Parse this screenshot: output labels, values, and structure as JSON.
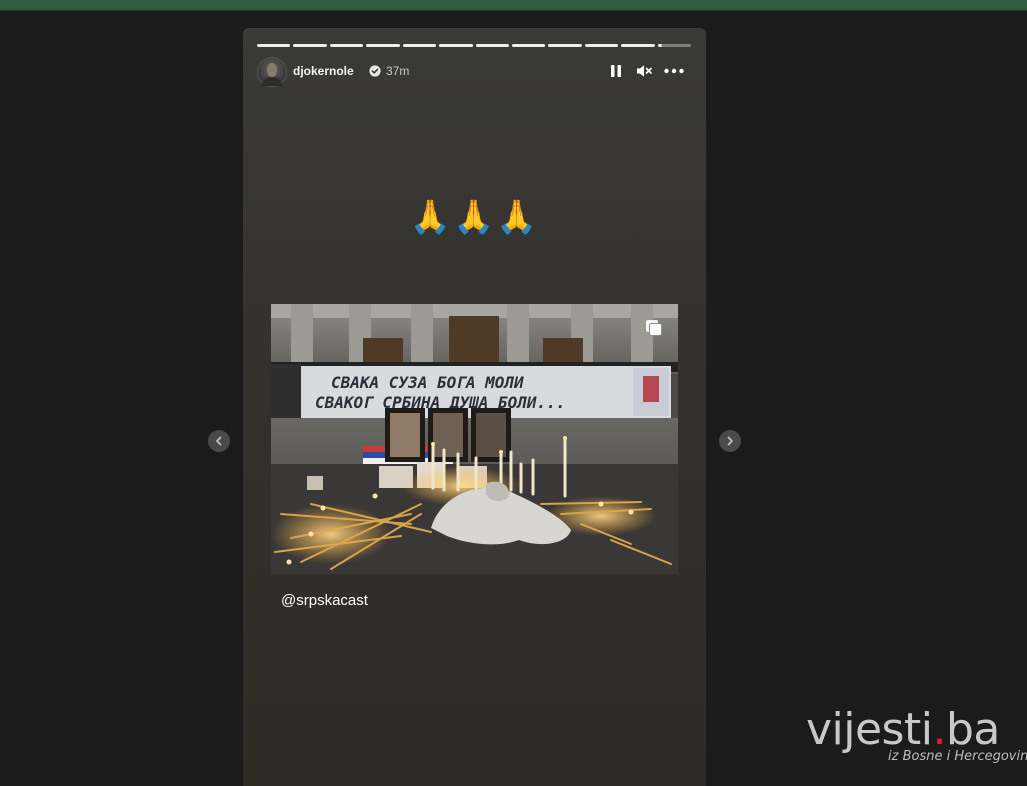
{
  "story": {
    "progress": {
      "segments_total": 12,
      "segments_completed": 11
    },
    "author": {
      "username": "djokernole",
      "verified": true,
      "time_ago": "37m"
    },
    "controls": {
      "pause_icon": "pause-icon",
      "mute_icon": "speaker-muted-icon",
      "more_icon": "more-horizontal-icon"
    },
    "emoji_text": "🙏🙏🙏",
    "shared_post": {
      "multi_image_icon": "carousel-icon",
      "banner_line1": "СВАКА СУЗА БОГА МОЛИ",
      "banner_line2": "СВАКОГ СРБИНА ДУША БОЛИ..."
    },
    "mention": "@srpskacast"
  },
  "navigation": {
    "prev_icon": "chevron-left-icon",
    "next_icon": "chevron-right-icon"
  },
  "watermark": {
    "logo_main": "vijesti",
    "logo_dot": ".",
    "logo_tld": "ba",
    "tagline": "iz Bosne i Hercegovine"
  },
  "colors": {
    "page_bg": "#1b1b1b",
    "top_strip": "#2f5c3c",
    "logo_dot": "#d7242f"
  }
}
